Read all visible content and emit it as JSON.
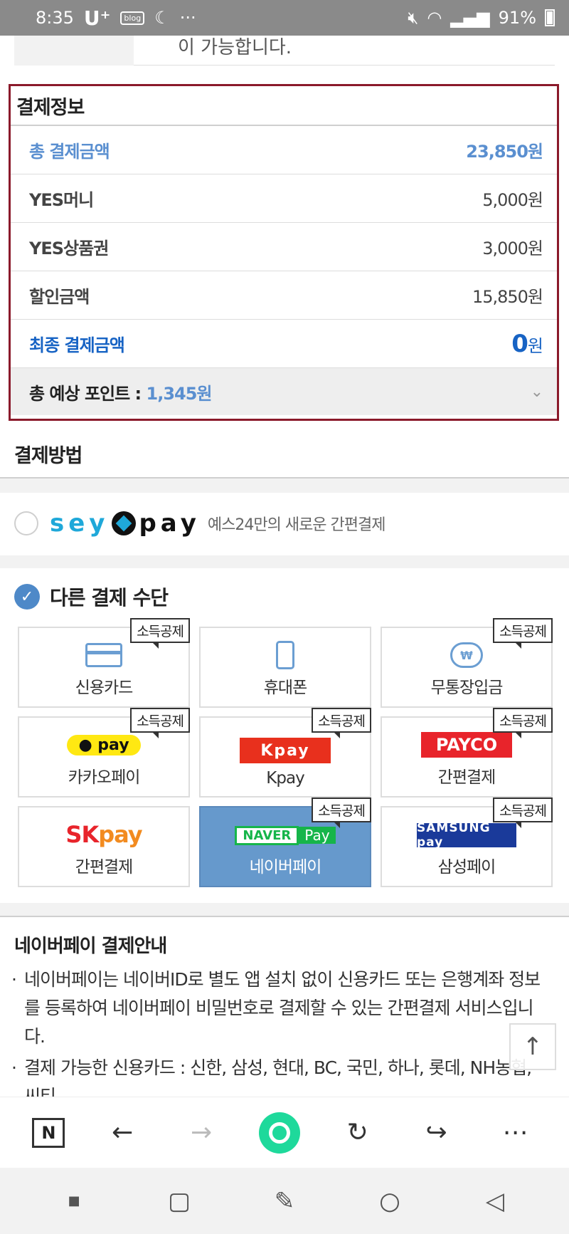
{
  "status_bar": {
    "time": "8:35",
    "carrier": "U⁺",
    "blog_badge": "blog",
    "more": "···",
    "battery": "91%"
  },
  "prev_section": {
    "text": "이 가능합니다."
  },
  "payment_info": {
    "title": "결제정보",
    "rows": [
      {
        "label": "총 결제금액",
        "value": "23,850원"
      },
      {
        "label": "YES머니",
        "value": "5,000원"
      },
      {
        "label": "YES상품권",
        "value": "3,000원"
      },
      {
        "label": "할인금액",
        "value": "15,850원"
      }
    ],
    "final": {
      "label": "최종 결제금액",
      "amount": "0",
      "unit": "원"
    },
    "points": {
      "label": "총 예상 포인트 : ",
      "value": "1,345원"
    }
  },
  "payment_method": {
    "title": "결제방법",
    "seypay": {
      "logo_left": "sey",
      "logo_right": "pay",
      "desc": "예스24만의 새로운 간편결제"
    },
    "other": {
      "label": "다른 결제 수단"
    },
    "badge_text": "소득공제",
    "options": [
      {
        "label": "신용카드",
        "badge": true,
        "logo": "card-icon",
        "logo_text": ""
      },
      {
        "label": "휴대폰",
        "badge": false,
        "logo": "phone-icon",
        "logo_text": ""
      },
      {
        "label": "무통장입금",
        "badge": true,
        "logo": "coin-icon",
        "logo_text": "₩"
      },
      {
        "label": "카카오페이",
        "badge": true,
        "logo": "kakaopay-logo",
        "logo_text": "● pay"
      },
      {
        "label": "Kpay",
        "badge": true,
        "logo": "kpay-logo",
        "logo_text": "Kp​ay"
      },
      {
        "label": "간편결제",
        "badge": true,
        "logo": "payco-logo",
        "logo_text": "PAYCO"
      },
      {
        "label": "간편결제",
        "badge": false,
        "logo": "skpay-logo",
        "logo_text": "SK pay"
      },
      {
        "label": "네이버페이",
        "badge": true,
        "logo": "naverpay-logo",
        "logo_text": "NAVER Pay"
      },
      {
        "label": "삼성페이",
        "badge": true,
        "logo": "samsungpay-logo",
        "logo_text": "SAMSUNG pay"
      }
    ],
    "selected_index": 7
  },
  "naverpay_guide": {
    "title": "네이버페이 결제안내",
    "items": [
      "네이버페이는 네이버ID로 별도 앱 설치 없이 신용카드 또는 은행계좌 정보를 등록하여 네이버페이 비밀번호로 결제할 수 있는 간편결제 서비스입니다.",
      "결제 가능한 신용카드 : 신한, 삼성, 현대, BC, 국민, 하나, 롯데, NH농협, 씨티"
    ]
  },
  "top_button": "↑",
  "browser_bar": {
    "n_label": "N"
  }
}
